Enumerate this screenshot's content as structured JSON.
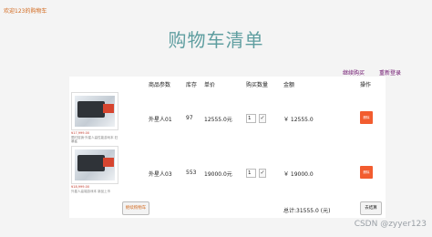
{
  "header": {
    "welcome": "欢迎123的购物车",
    "title": "购物车清单",
    "links": [
      "继续购买",
      "重新登录"
    ]
  },
  "table": {
    "columns": [
      "商品参数",
      "库存",
      "单价",
      "购买数量",
      "金额",
      "操作"
    ],
    "rows": [
      {
        "image_caption": "¥17,999.00",
        "image_sub": "限时促销·外星人高性能游戏本 狂暴鲨",
        "name": "外星人01",
        "stock": "97",
        "price": "12555.0元",
        "quantity": "1",
        "amount": "￥   12555.0",
        "delete_label": "删除"
      },
      {
        "image_caption": "¥18,999.00",
        "image_sub": "外星人高端游戏本 新品上市",
        "name": "外星人03",
        "stock": "553",
        "price": "19000.0元",
        "quantity": "1",
        "amount": "￥   19000.0",
        "delete_label": "删除"
      }
    ]
  },
  "footer": {
    "continue_label": "继续购物车",
    "total": "总计:31555.0 (元)",
    "checkout_label": "去结算"
  },
  "watermark": "CSDN @zyyer123",
  "colors": {
    "title": "#5f9ea0",
    "link": "#6a0d6a",
    "delete_button": "#f25c2f",
    "welcome": "#d2691e"
  },
  "icons": [
    "check-icon",
    "product-image"
  ]
}
